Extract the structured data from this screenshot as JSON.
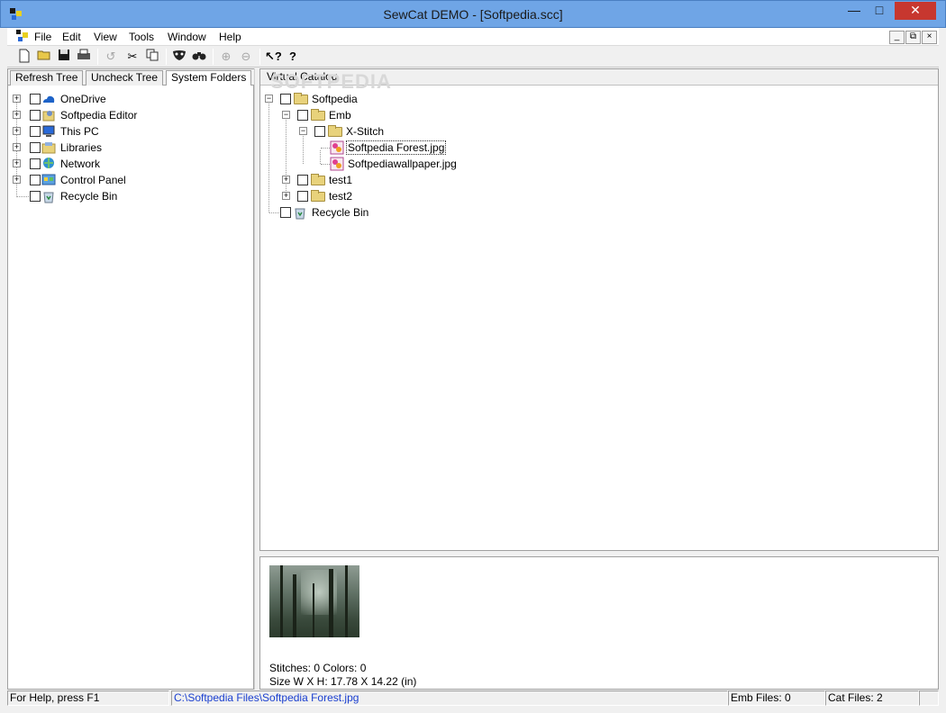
{
  "window": {
    "title": "SewCat DEMO - [Softpedia.scc]"
  },
  "menu": [
    "File",
    "Edit",
    "View",
    "Tools",
    "Window",
    "Help"
  ],
  "left_tabs": [
    "Refresh Tree",
    "Uncheck Tree",
    "System Folders"
  ],
  "system_tree": [
    {
      "label": "OneDrive",
      "icon": "onedrive-icon"
    },
    {
      "label": "Softpedia Editor",
      "icon": "user-folder-icon"
    },
    {
      "label": "This PC",
      "icon": "computer-icon"
    },
    {
      "label": "Libraries",
      "icon": "libraries-icon"
    },
    {
      "label": "Network",
      "icon": "network-icon"
    },
    {
      "label": "Control Panel",
      "icon": "control-panel-icon"
    },
    {
      "label": "Recycle Bin",
      "icon": "recycle-bin-icon"
    }
  ],
  "virtual_catalog": {
    "header": "Virtual Catalog",
    "root": "Softpedia",
    "emb": "Emb",
    "xstitch": "X-Stitch",
    "file1": "Softpedia Forest.jpg",
    "file2": "Softpediawallpaper.jpg",
    "test1": "test1",
    "test2": "test2",
    "recycle": "Recycle Bin"
  },
  "preview": {
    "stitches": "Stitches: 0 Colors: 0",
    "size": "Size W X H: 17.78 X 14.22 (in)"
  },
  "statusbar": {
    "help": "For Help, press F1",
    "path": "C:\\Softpedia Files\\Softpedia Forest.jpg",
    "emb_files": "Emb Files: 0",
    "cat_files": "Cat Files: 2"
  },
  "watermark": "SOFTPEDIA"
}
